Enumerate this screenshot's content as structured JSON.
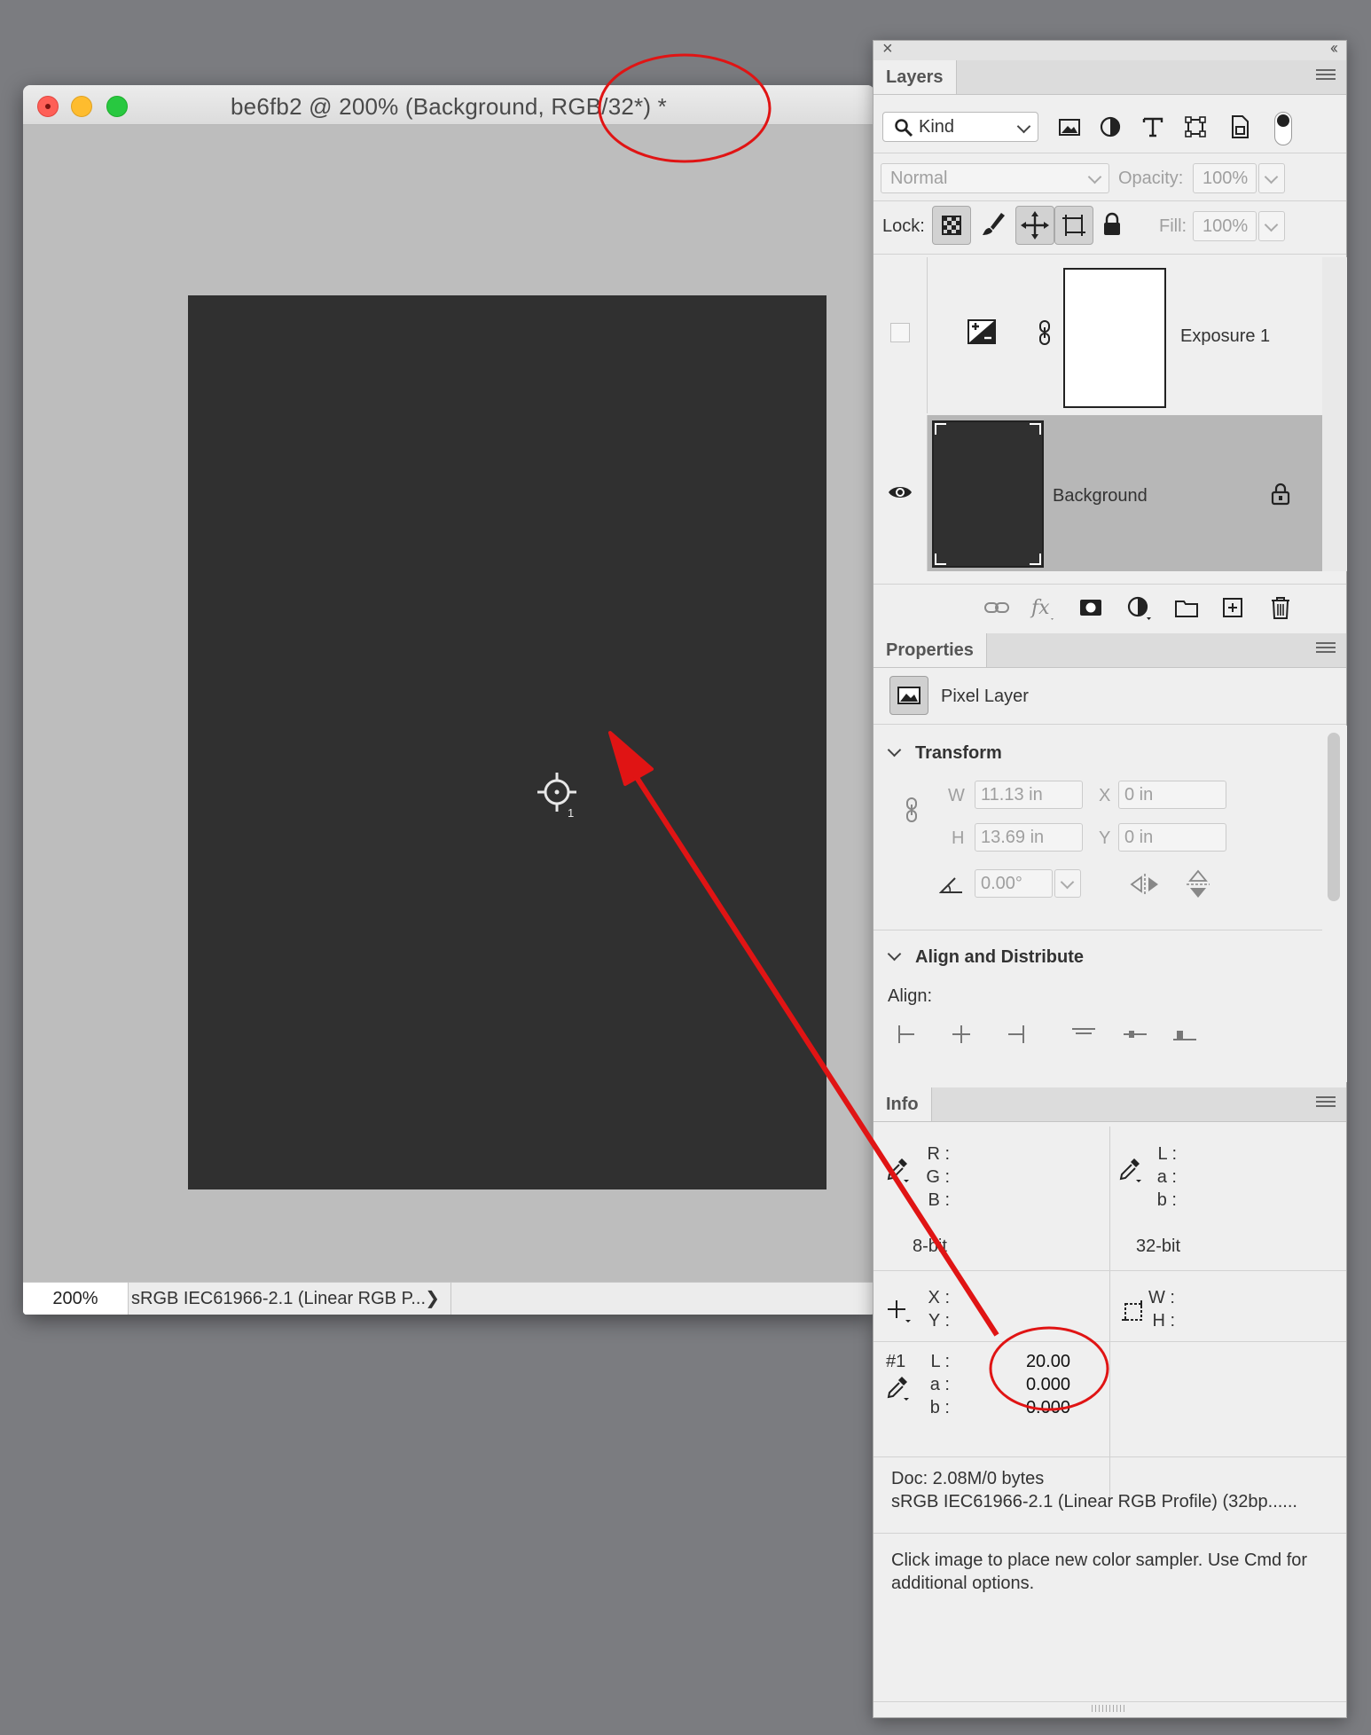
{
  "document": {
    "title": "be6fb2 @ 200% (Background, RGB/32*) *",
    "zoom": "200%",
    "profile": "sRGB IEC61966-2.1 (Linear RGB P...",
    "image_color": "#303030",
    "sampler_number": "1"
  },
  "layers_panel": {
    "tab": "Layers",
    "kind_label": "Kind",
    "blend_mode": "Normal",
    "opacity_label": "Opacity:",
    "opacity_value": "100%",
    "lock_label": "Lock:",
    "fill_label": "Fill:",
    "fill_value": "100%",
    "layers": [
      {
        "name": "Exposure 1",
        "visible": false,
        "selected": false
      },
      {
        "name": "Background",
        "visible": true,
        "selected": true,
        "locked": true
      }
    ]
  },
  "properties_panel": {
    "tab": "Properties",
    "layer_type": "Pixel Layer",
    "transform_title": "Transform",
    "w_label": "W",
    "w_value": "11.13 in",
    "h_label": "H",
    "h_value": "13.69 in",
    "x_label": "X",
    "x_value": "0 in",
    "y_label": "Y",
    "y_value": "0 in",
    "angle_value": "0.00°",
    "align_title": "Align and Distribute",
    "align_label": "Align:"
  },
  "info_panel": {
    "tab": "Info",
    "rgb_labels": [
      "R :",
      "G :",
      "B :"
    ],
    "lab_labels": [
      "L :",
      "a :",
      "b :"
    ],
    "left_mode": "8-bit",
    "right_mode": "32-bit",
    "xy_labels": [
      "X :",
      "Y :"
    ],
    "wh_labels": [
      "W :",
      "H :"
    ],
    "sampler": {
      "id": "#1",
      "labels": [
        "L :",
        "a :",
        "b :"
      ],
      "values": [
        "20.00",
        "0.000",
        "0.000"
      ]
    },
    "doc_size": "Doc: 2.08M/0 bytes",
    "doc_profile": "sRGB IEC61966-2.1 (Linear RGB Profile) (32bp......",
    "hint": "Click image to place new color sampler.  Use Cmd for additional options."
  },
  "colors": {
    "annotation_red": "#e01414",
    "selected_layer": "#b7b7b7"
  }
}
